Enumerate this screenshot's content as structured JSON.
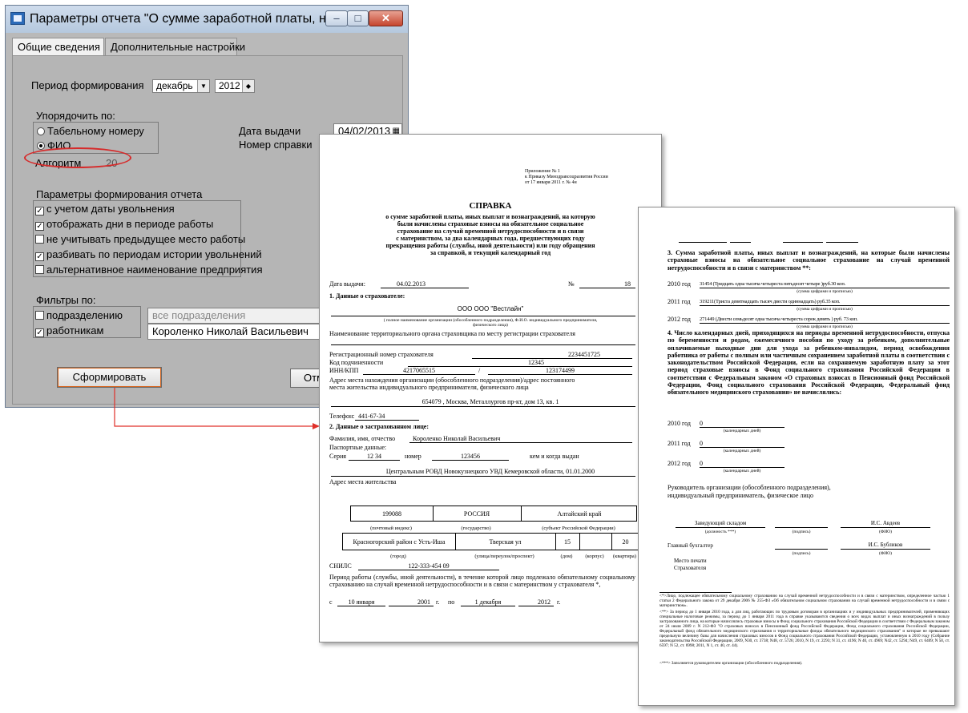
{
  "window": {
    "title": "Параметры отчета \"О сумме заработной платы, на кото...",
    "buttons": {
      "minimize": "–",
      "maximize": "□",
      "close": "✕"
    },
    "tabs": [
      {
        "label": "Общие сведения",
        "active": true
      },
      {
        "label": "Дополнительные настройки",
        "active": false
      }
    ]
  },
  "form": {
    "period_label": "Период формирования",
    "month": "декабрь",
    "year": "2012",
    "sort_group_label": "Упорядочить по:",
    "sort_options": [
      {
        "label": "Табельному номеру",
        "selected": false
      },
      {
        "label": "ФИО",
        "selected": true
      }
    ],
    "issue_date_label": "Дата выдачи",
    "issue_date": "04/02/2013",
    "cert_number_label": "Номер справки",
    "algorithm_label": "Алгоритм",
    "algorithm_value": "20",
    "params_label": "Параметры формирования отчета",
    "params": [
      {
        "label": "с учетом даты увольнения",
        "checked": true
      },
      {
        "label": "отображать дни в периоде работы",
        "checked": true
      },
      {
        "label": "не учитывать предыдущее место работы",
        "checked": false
      },
      {
        "label": "разбивать по периодам истории увольнений",
        "checked": true
      },
      {
        "label": "альтернативное наименование предприятия",
        "checked": false
      }
    ],
    "filters_label": "Фильтры по:",
    "filters": [
      {
        "label": "подразделению",
        "checked": false,
        "value": "все подразделения"
      },
      {
        "label": "работникам",
        "checked": true,
        "value": "Короленко Николай Васильевич"
      }
    ],
    "generate_button": "Сформировать",
    "cancel_button": "Отме"
  },
  "doc1": {
    "appendix": [
      "Приложение № 1",
      "к Приказу Минздравсоцразвития России",
      "от 17 января 2011 г. № 4н"
    ],
    "title": "СПРАВКА",
    "subtitle": [
      "о сумме заработной платы, иных выплат и вознаграждений, на которую",
      "были начислены страховые взносы на обязательное социальное",
      "страхование на случай временной нетрудоспособности и в связи",
      "с материнством, за два календарных года, предшествующих году",
      "прекращения работы (службы, иной деятельности) или году обращения",
      "за справкой, и текущий календарный год"
    ],
    "issue_label": "Дата выдачи:",
    "issue_value": "04.02.2013",
    "number_label": "№",
    "number_value": "18",
    "s1": "1. Данные о страхователе:",
    "org": "ООО ООО \"Вестлайн\"",
    "org_note": [
      "( полное наименование организации (обособленного подразделения), Ф.И.О.  индивидуального предпринимателя,",
      "физического лица)"
    ],
    "terr_label": "Наименование территориального органа страховщика по месту регистрации страхователя",
    "reg_label": "Регистрационный номер страхователя",
    "reg_value": "2234451725",
    "sub_label": "Код подчиненности",
    "sub_value": "12345",
    "inn_label": "ИНН/КПП",
    "inn_value": "4217065515",
    "slash": "/",
    "kpp_value": "123174499",
    "addr_label": [
      "Адрес места нахождения организации (обособленного подразделения)/адрес постоянного",
      "места жительства индивидуального предпринимателя, физического лица"
    ],
    "addr_value": "654079 , Москва, Металлургов пр-кт, дом 13, кв. 1",
    "phone_label": "Телефон:",
    "phone_value": "441-67-34",
    "s2": "2. Данные о застрахованном лице:",
    "fio_label": "Фамилия, имя, отчество",
    "fio_value": "Короленко Николай Васильевич",
    "pass_label": "Паспортные данные:",
    "series_label": "Серия",
    "series_value": "12 34",
    "num_label": "номер",
    "num_value": "123456",
    "issued_label": "кем и когда выдан",
    "issued_value": "Центральным РОВД Новокузнецкого УВД Кемеровской области, 01.01.2000",
    "res_label": "Адрес места жительства",
    "addr_row1": [
      "199088",
      "РОССИЯ",
      "Алтайский край"
    ],
    "addr_cap1": [
      "(почтовый индекс)",
      "(государство)",
      "(субъект Российской Федерации)"
    ],
    "addr_row2": [
      "Красногорский район с Усть-Иша",
      "Тверская ул",
      "15",
      "",
      "20"
    ],
    "addr_cap2": [
      "(город)",
      "(улица/переулок/проспект)",
      "(дом)",
      "(корпус)",
      "(квартира)"
    ],
    "snils_label": "СНИЛС",
    "snils_value": "122-333-454 09",
    "period_text": "Период работы (службы, иной деятельности), в течение которой лицо подлежало обязательному социальному страхованию на случай временной нетрудоспособности и в связи с материнством у страхователя *,",
    "from_label": "с",
    "from_day": "10 января",
    "from_year": "2001",
    "g1": "г.",
    "to_label": "по",
    "to_day": "1 декабря",
    "to_year": "2012",
    "g2": "г."
  },
  "doc2": {
    "s3": "3. Сумма заработной платы, иных выплат и вознаграждений, на которые были начислены страховые взносы на обязательное социальное страхование на случай временной нетрудоспособности и в связи с материнством **:",
    "years": [
      {
        "label": "2010 год",
        "value": "31454 (Тридцать одна тысяча четыреста пятьдесят четыре )руб.30 коп."
      },
      {
        "label": "2011 год",
        "value": "319211(Триста девятнадцать тысяч двести одиннадцать) руб.35 коп."
      },
      {
        "label": "2012 год",
        "value": "271449 (Двести семьдесят одна тысяча четыреста сорок девять ) руб. 73 коп."
      }
    ],
    "sum_cap": "(сумма цифрами и прописью)",
    "s4": "4. Число календарных дней, приходящихся на периоды временной нетрудоспособности, отпуска по беременности и родам, ежемесячного пособия по уходу за ребенком, дополнительные оплачиваемые выходные дни для ухода за ребенком-инвалидом, период освобождения работника от работы с полным или частичным сохранением заработной платы в соответствии с законодательством Российской Федерации, если на сохраняемую заработную плату за этот период страховые взносы в Фонд социального страхования Российской Федерации в соответствии с Федеральным законом «О страховых взносах в Пенсионный фонд Российской Федерации, Фонд социального страхования Российской Федерации, Федеральный фонд обязательного медицинского страхования» не начислялись:",
    "days": [
      {
        "label": "2010 год",
        "value": "0"
      },
      {
        "label": "2011 год",
        "value": "0"
      },
      {
        "label": "2012 год",
        "value": "0"
      }
    ],
    "days_cap": "(календарных дней)",
    "head_text": [
      "Руководитель организации (обособленного подразделения),",
      "индивидуальный предприниматель,  физическое лицо"
    ],
    "sign1_pos": "Заведующий складом",
    "sign1_name": "И.С. Авдеев",
    "sign_cap_pos": "(должность ***)",
    "sign_cap_sig": "(подпись)",
    "sign_cap_fio": "(ФИО)",
    "sign2_pos": "Главный бухгалтер",
    "sign2_name": "И.С. Бубликов",
    "stamp": [
      "Место печати",
      "Страхователя"
    ],
    "foot1": "<*>Лицо, подлежащее обязательному социальному страхованию на случай временной нетрудоспособности и в связи с материнством, определенное частью 1 статьи 2 Федерального закона от 29 декабря 2006 № 255-ФЗ «Об обязательном социальном страховании на случай временной нетрудоспособности и в связи с материнством».",
    "foot2": "<**> За период до 1 января 2010 года, а для лиц, работающих по трудовым договорам в организациях и у индивидуальных предпринимателей, применяющих специальные налоговые режимы, за период до 1 января 2011 года в справке указываются сведения о всех видах выплат и иных вознаграждений в пользу застрахованного лица, на которые начислялись страховые взносы в Фонд социального страхования Российской Федерации в соответствии с Федеральным законом от 24 июля 2009 г. N 212-ФЗ \"О страховых взносах в Пенсионный фонд Российской Федерации, Фонд социального страхования Российской Федерации, Федеральный фонд обязательного медицинского страхования и территориальные фонды обязательного медицинского страхования\" и которые не превышают предельную величину базы для начисления страховых взносов в Фонд социального страхования Российской Федерации, установленную в 2010 году (Собрание законодательства Российской Федерации, 2009, N30, ст. 3738; N48, ст. 5726; 2010, N 19, ст. 2293; N 31, ст. 4196; N 40, ст. 4969; N42, ст. 5294; N49, ст. 6409; N 50, ст. 6597; N 52, ст. 6998; 2011, N 1, ст. 40, ст. 44).",
    "foot3": "<***> Заполняется руководителем организации (обособленного подразделения)."
  }
}
